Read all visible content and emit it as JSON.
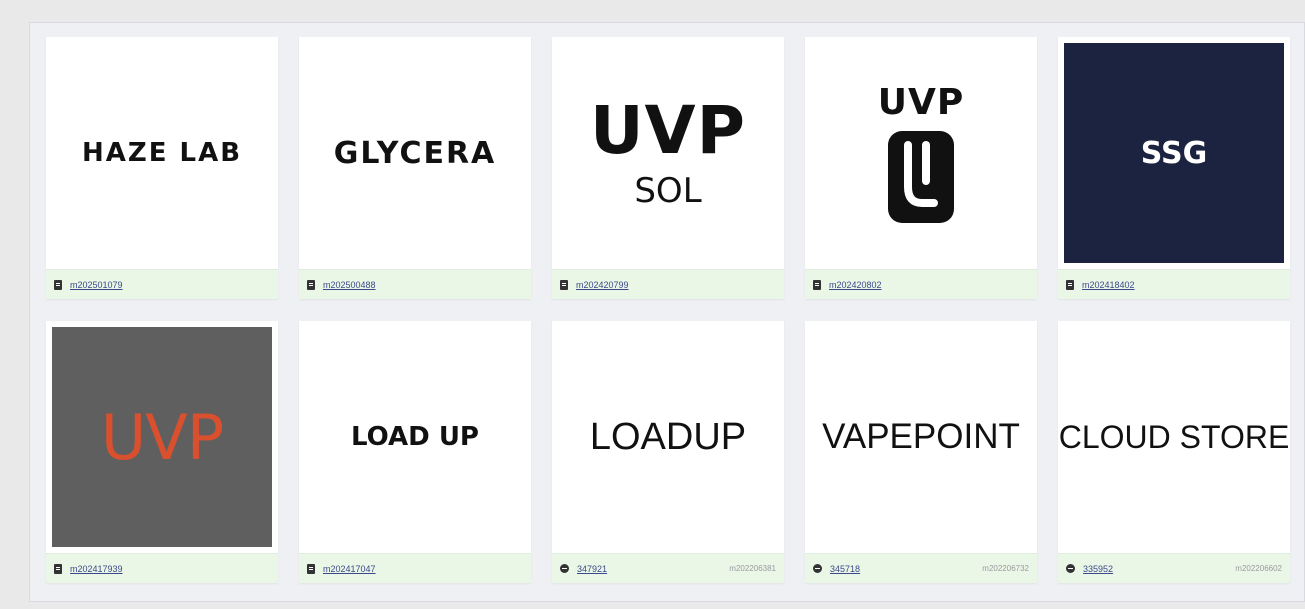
{
  "row1": [
    {
      "logo": "HAZE LAB",
      "id": "m202501079",
      "icon": "document-icon"
    },
    {
      "logo": "GLYCERA",
      "id": "m202500488",
      "icon": "document-icon"
    },
    {
      "logo_line1": "UVP",
      "logo_line2": "SOL",
      "id": "m202420799",
      "icon": "document-icon"
    },
    {
      "logo": "UVP",
      "id": "m202420802",
      "icon": "document-icon"
    },
    {
      "logo": "SSG",
      "id": "m202418402",
      "icon": "document-icon"
    }
  ],
  "row2": [
    {
      "logo": "UVP",
      "id": "m202417939",
      "icon": "document-icon"
    },
    {
      "logo": "LOAD UP",
      "id": "m202417047",
      "icon": "document-icon"
    },
    {
      "logo": "LOADUP",
      "id": "347921",
      "ref": "m202206381",
      "icon": "registered-icon"
    },
    {
      "logo": "VAPEPOINT",
      "id": "345718",
      "ref": "m202206732",
      "icon": "registered-icon"
    },
    {
      "logo": "CLOUD STORE",
      "id": "335952",
      "ref": "m202206602",
      "icon": "registered-icon"
    }
  ],
  "colors": {
    "ssg_background": "#1b2340",
    "uvp_grey_background": "#5f5f5f",
    "uvp_orange": "#d9502e",
    "footer_green": "#eaf6e6"
  }
}
